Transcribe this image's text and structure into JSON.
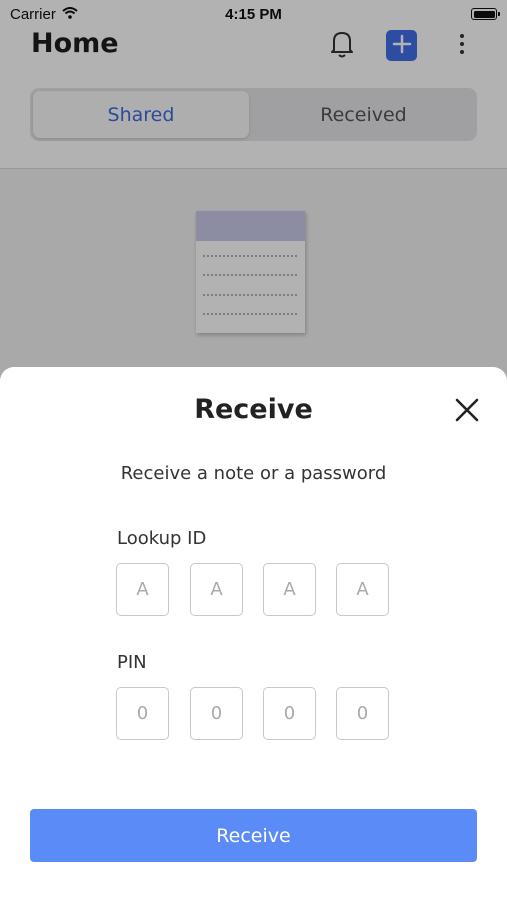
{
  "status_bar": {
    "carrier": "Carrier",
    "time": "4:15 PM"
  },
  "header": {
    "title": "Home",
    "icons": [
      "bell-icon",
      "plus-icon",
      "more-vertical-icon"
    ],
    "accent_color": "#3f6fe8"
  },
  "tabs": [
    {
      "label": "Shared",
      "selected": true
    },
    {
      "label": "Received",
      "selected": false
    }
  ],
  "sheet": {
    "title": "Receive",
    "subtitle": "Receive a note or a password",
    "lookup_label": "Lookup ID",
    "lookup_placeholders": [
      "A",
      "A",
      "A",
      "A"
    ],
    "pin_label": "PIN",
    "pin_placeholders": [
      "0",
      "0",
      "0",
      "0"
    ],
    "button_label": "Receive",
    "button_color": "#5b8bf6"
  }
}
